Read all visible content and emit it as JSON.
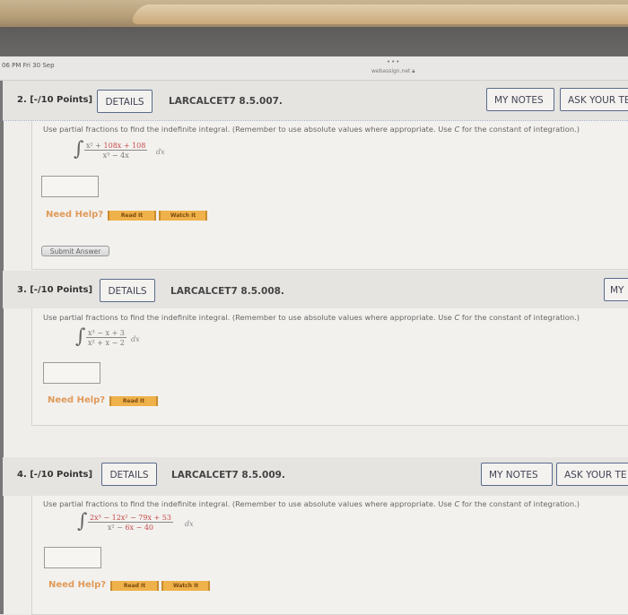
{
  "status_bar": {
    "time": "06 PM  Fri 30 Sep",
    "dots": "•••",
    "url": "webassign.net",
    "lock_icon": "lock-icon"
  },
  "questions": [
    {
      "title": "2. [-/10 Points]",
      "details_label": "DETAILS",
      "code": "LARCALCET7 8.5.007.",
      "my_notes_label": "MY NOTES",
      "ask_label": "ASK YOUR TE",
      "prompt_pre": "Use partial fractions to find the indefinite integral. (Remember to use absolute values where appropriate. Use ",
      "prompt_c": "C",
      "prompt_post": " for the constant of integration.)",
      "numerator_lead": "x² + ",
      "numerator_rest": "108x + 108",
      "denominator": "x³ − 4x",
      "denominator_red": "",
      "dx": "dx",
      "answer_value": "",
      "need_help": "Need Help?",
      "read_it": "Read It",
      "watch_it": "Watch It",
      "submit": "Submit Answer"
    },
    {
      "title": "3. [-/10 Points]",
      "details_label": "DETAILS",
      "code": "LARCALCET7 8.5.008.",
      "my_notes_label": "MY",
      "prompt_pre": "Use partial fractions to find the indefinite integral. (Remember to use absolute values where appropriate. Use ",
      "prompt_c": "C",
      "prompt_post": " for the constant of integration.)",
      "numerator": "x³ − x + 3",
      "denominator": "x² + x − 2",
      "dx": "dx",
      "answer_value": "",
      "need_help": "Need Help?",
      "read_it": "Read It"
    },
    {
      "title": "4. [-/10 Points]",
      "details_label": "DETAILS",
      "code": "LARCALCET7 8.5.009.",
      "my_notes_label": "MY NOTES",
      "ask_label": "ASK YOUR TE",
      "prompt_pre": "Use partial fractions to find the indefinite integral. (Remember to use absolute values where appropriate. Use ",
      "prompt_c": "C",
      "prompt_post": " for the constant of integration.)",
      "numerator": "2x³ − 12x² − 79x + 53",
      "denominator_lead": "x² − ",
      "denominator_rest": "6x − 40",
      "dx": "dx",
      "answer_value": "",
      "need_help": "Need Help?",
      "read_it": "Read It",
      "watch_it": "Watch It"
    }
  ]
}
